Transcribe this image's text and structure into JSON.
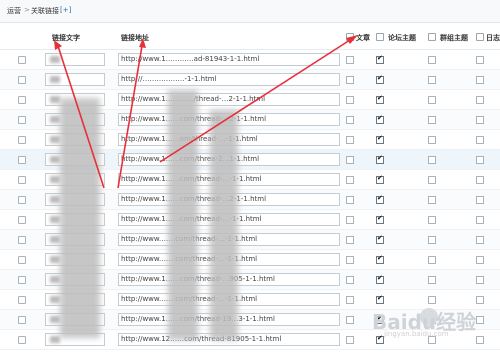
{
  "breadcrumb": {
    "part1": "运营",
    "separator": ">",
    "part2": "关联链接",
    "add_label": "[+]"
  },
  "headers": {
    "link_text": "链接文字",
    "link_url": "链接地址",
    "article": "文章",
    "forum_thread": "论坛主题",
    "group_thread": "群组主题",
    "blog": "日志"
  },
  "rows": [
    {
      "url": "http://www.1…………ad-81943-1-1.html",
      "forum_checked": true
    },
    {
      "url": "http://………………-1-1.html",
      "forum_checked": true
    },
    {
      "url": "http://www.1…………/thread-…2-1-1.html",
      "forum_checked": true
    },
    {
      "url": "http://www.1……com/thread-…2-1-1.html",
      "forum_checked": true
    },
    {
      "url": "http://www.1……om/thread-…-1-1.html",
      "forum_checked": true
    },
    {
      "url": "http://www.1……com/threa-2…1-1.html",
      "forum_checked": true
    },
    {
      "url": "http://www.1……com/thread-…-1-1.html",
      "forum_checked": true
    },
    {
      "url": "http://www.1……com/thread-…2-1-1.html",
      "forum_checked": true
    },
    {
      "url": "http://www.1……com/thread-…-1-1.html",
      "forum_checked": true
    },
    {
      "url": "http://www.……com/thread-…-1-1.html",
      "forum_checked": true
    },
    {
      "url": "http://www.……com/thread-…-1-1.html",
      "forum_checked": true
    },
    {
      "url": "http://www.1……com/thread-…905-1-1.html",
      "forum_checked": true
    },
    {
      "url": "http://www.……com/thread-…-1-1.html",
      "forum_checked": true
    },
    {
      "url": "http://www.1……com/thread-19…3-1-1.html",
      "forum_checked": true
    },
    {
      "url": "http://www.12……com/thread-81905-1-1.html",
      "forum_checked": true
    }
  ],
  "watermark": {
    "brand": "Baidu经验",
    "sub": "jingyan.baidu.com"
  },
  "colors": {
    "arrow": "#e8303a",
    "border": "#c4ccd3"
  }
}
